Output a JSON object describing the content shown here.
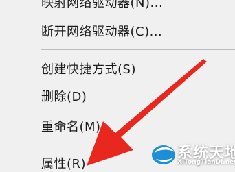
{
  "context_menu": {
    "items": [
      {
        "label": "映射网络驱动器(N)..."
      },
      {
        "label": "断开网络驱动器(C)..."
      },
      {
        "label": "创建快捷方式(S)"
      },
      {
        "label": "删除(D)"
      },
      {
        "label": "重命名(M)"
      },
      {
        "label": "属性(R)"
      }
    ]
  },
  "annotation": {
    "arrow_color": "#e8281e"
  },
  "watermark": {
    "title": "系统天地",
    "url": "XiTongTianDi.net",
    "logo_color": "#1e8fd6"
  }
}
